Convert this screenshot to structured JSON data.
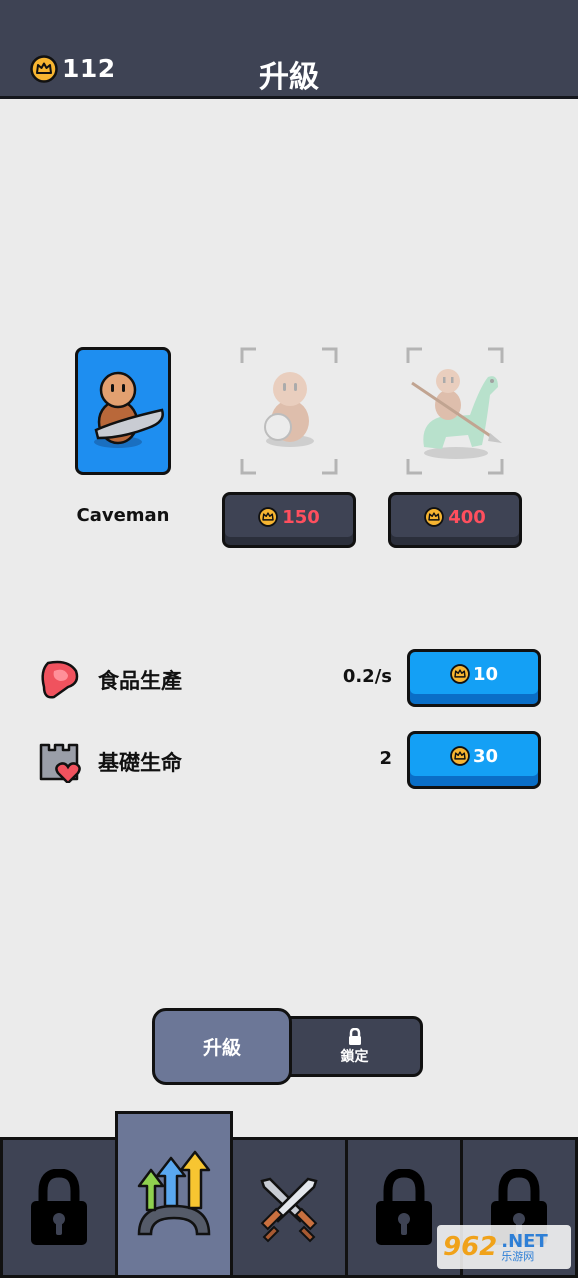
{
  "header": {
    "coins": "112",
    "title": "升級"
  },
  "units": [
    {
      "name": "Caveman",
      "state": "selected"
    },
    {
      "price": "150",
      "state": "locked"
    },
    {
      "price": "400",
      "state": "locked"
    }
  ],
  "stats": [
    {
      "icon": "meat-icon",
      "label": "食品生產",
      "value": "0.2/s",
      "price": "10"
    },
    {
      "icon": "castle-heart-icon",
      "label": "基礎生命",
      "value": "2",
      "price": "30"
    }
  ],
  "segmented": {
    "upgrade_label": "升級",
    "locked_label": "鎖定"
  },
  "nav": [
    {
      "icon": "lock-icon",
      "state": "locked"
    },
    {
      "icon": "upgrade-arrows-icon",
      "state": "active"
    },
    {
      "icon": "crossed-swords-icon",
      "state": "normal"
    },
    {
      "icon": "lock-icon",
      "state": "locked"
    },
    {
      "icon": "lock-icon",
      "state": "locked"
    }
  ],
  "watermark": {
    "number": "962",
    "suffix": ".NET",
    "sub": "乐游网"
  },
  "colors": {
    "header": "#3e4354",
    "accent_blue": "#14a0f5",
    "price_red": "#ff4f5e",
    "crown_gold": "#f7b531"
  }
}
